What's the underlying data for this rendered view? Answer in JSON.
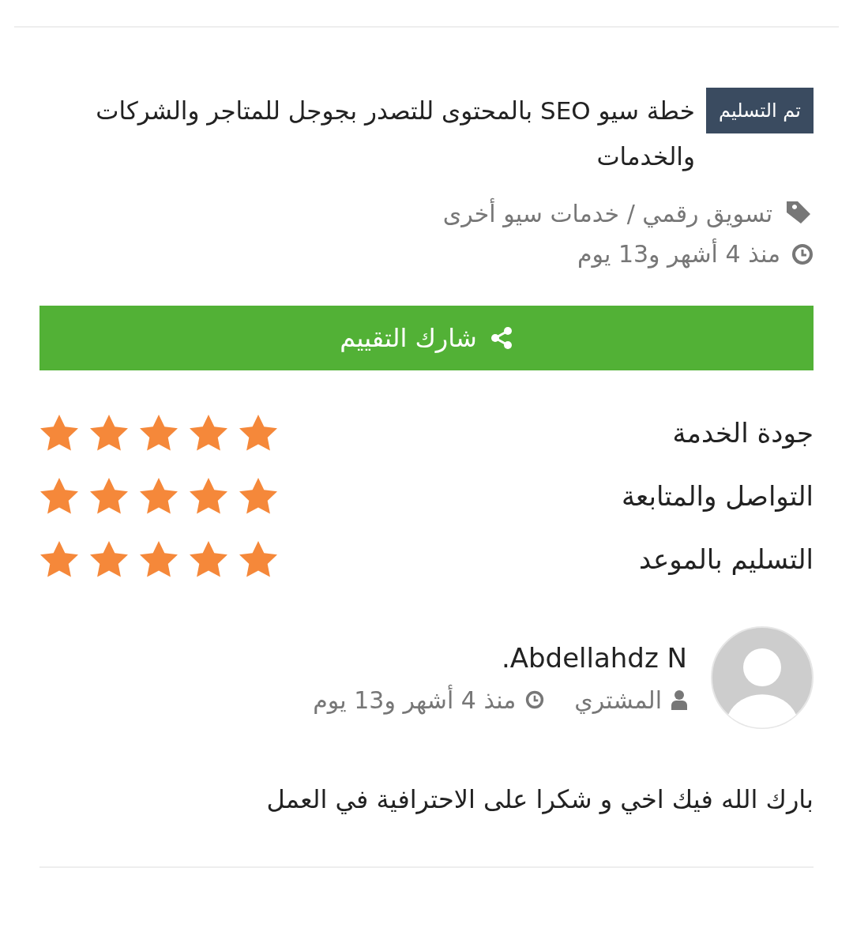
{
  "order": {
    "status_badge": "تم التسليم",
    "title": "خطة سيو SEO بالمحتوى للتصدر بجوجل للمتاجر والشركات والخدمات",
    "category": "تسويق رقمي / خدمات سيو أخرى",
    "time": "منذ 4 أشهر و13 يوم"
  },
  "share_button": "شارك التقييم",
  "ratings": [
    {
      "label": "جودة الخدمة",
      "stars": 5
    },
    {
      "label": "التواصل والمتابعة",
      "stars": 5
    },
    {
      "label": "التسليم بالموعد",
      "stars": 5
    }
  ],
  "review": {
    "name": "Abdellahdz N.",
    "role": "المشتري",
    "time": "منذ 4 أشهر و13 يوم",
    "comment": "بارك الله فيك اخي و شكرا على الاحترافية في العمل"
  }
}
